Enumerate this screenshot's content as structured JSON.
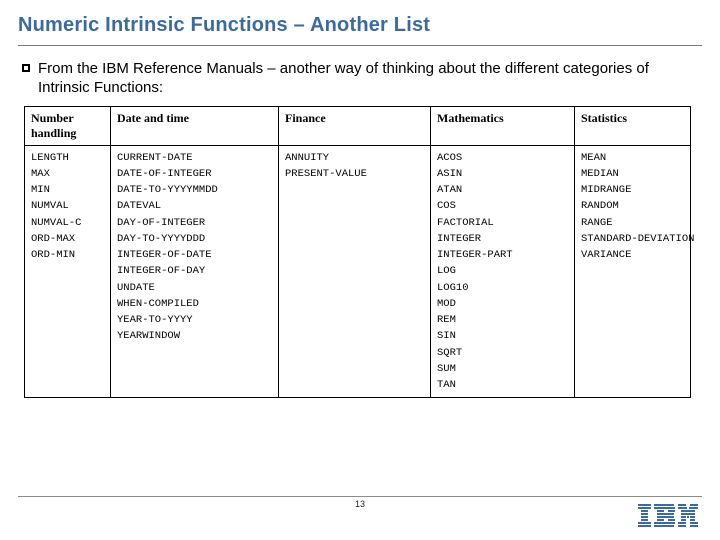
{
  "title": "Numeric Intrinsic Functions – Another List",
  "bullet": "From the IBM Reference Manuals – another way of thinking about the different categories of Intrinsic Functions:",
  "page_number": "13",
  "table": {
    "headers": {
      "number": "Number handling",
      "date": "Date and time",
      "finance": "Finance",
      "math": "Mathematics",
      "stats": "Statistics"
    },
    "columns": {
      "number": [
        "LENGTH",
        "MAX",
        "MIN",
        "NUMVAL",
        "NUMVAL-C",
        "ORD-MAX",
        "ORD-MIN"
      ],
      "date": [
        "CURRENT-DATE",
        "DATE-OF-INTEGER",
        "DATE-TO-YYYYMMDD",
        "DATEVAL",
        "DAY-OF-INTEGER",
        "DAY-TO-YYYYDDD",
        "INTEGER-OF-DATE",
        "INTEGER-OF-DAY",
        "UNDATE",
        "WHEN-COMPILED",
        "YEAR-TO-YYYY",
        "YEARWINDOW"
      ],
      "finance": [
        "ANNUITY",
        "PRESENT-VALUE"
      ],
      "math": [
        "ACOS",
        "ASIN",
        "ATAN",
        "COS",
        "FACTORIAL",
        "INTEGER",
        "INTEGER-PART",
        "LOG",
        "LOG10",
        "MOD",
        "REM",
        "SIN",
        "SQRT",
        "SUM",
        "TAN"
      ],
      "stats": [
        "MEAN",
        "MEDIAN",
        "MIDRANGE",
        "RANDOM",
        "RANGE",
        "STANDARD-DEVIATION",
        "VARIANCE"
      ]
    }
  },
  "logo_label": "IBM"
}
